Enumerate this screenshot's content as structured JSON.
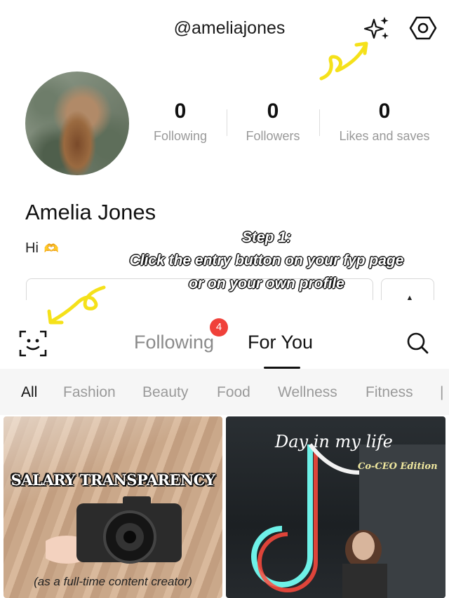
{
  "profile": {
    "username": "@ameliajones",
    "name": "Amelia Jones",
    "bio": "Hi",
    "bio_emoji": "🫶",
    "stats": [
      {
        "value": "0",
        "label": "Following"
      },
      {
        "value": "0",
        "label": "Followers"
      },
      {
        "value": "0",
        "label": "Likes and saves"
      }
    ]
  },
  "overlay": {
    "line1": "Step 1:",
    "line2": "Click the entry button on your fyp page",
    "line3": "or on your own profile",
    "arrow_color": "#f5e11a"
  },
  "fyp": {
    "tabs": [
      "Following",
      "For You"
    ],
    "following_badge": "4",
    "categories": [
      "All",
      "Fashion",
      "Beauty",
      "Food",
      "Wellness",
      "Fitness"
    ]
  },
  "cards": {
    "left": {
      "headline": "SALARY TRANSPARENCY",
      "caption": "(as a full-time content creator)"
    },
    "right": {
      "headline": "Day in my life",
      "subheadline": "Co-CEO Edition"
    }
  },
  "icons": [
    "sparkle-icon",
    "settings-icon",
    "face-scan-icon",
    "search-icon"
  ]
}
